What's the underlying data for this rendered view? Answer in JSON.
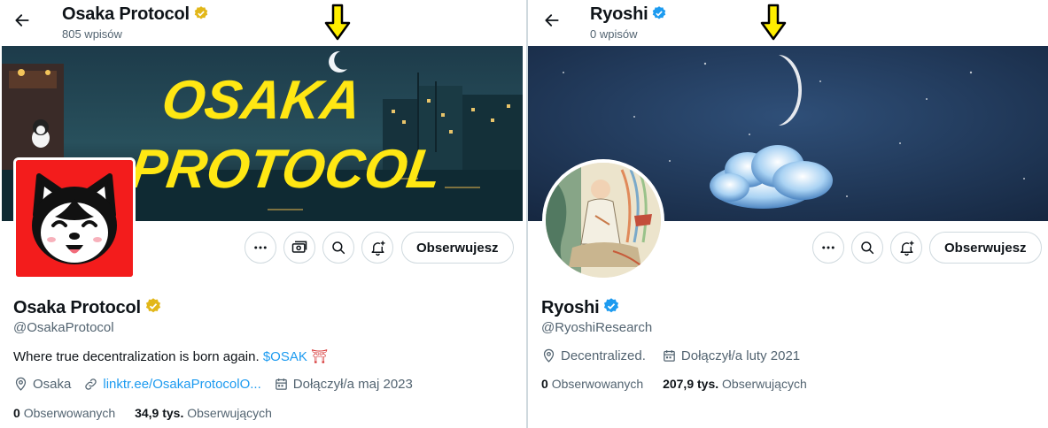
{
  "left": {
    "header": {
      "title": "Osaka Protocol",
      "posts_count": "805 wpisów"
    },
    "banner": {
      "text_line1": "OSAKA",
      "text_line2": "PROTOCOL"
    },
    "profile": {
      "name": "Osaka Protocol",
      "handle": "@OsakaProtocol",
      "bio_text": "Where true decentralization is born again.",
      "bio_cashtag": "$OSAK",
      "bio_emoji": "⛩",
      "location": "Osaka",
      "link": "linktr.ee/OsakaProtocolO...",
      "joined": "Dołączył/a maj 2023",
      "following_count": "0",
      "following_label": "Obserwowanych",
      "followers_count": "34,9 tys.",
      "followers_label": "Obserwujących"
    },
    "actions": {
      "follow_label": "Obserwujesz"
    },
    "badge_color": "#e2b719"
  },
  "right": {
    "header": {
      "title": "Ryoshi",
      "posts_count": "0 wpisów"
    },
    "profile": {
      "name": "Ryoshi",
      "handle": "@RyoshiResearch",
      "location": "Decentralized.",
      "joined": "Dołączył/a luty 2021",
      "following_count": "0",
      "following_label": "Obserwowanych",
      "followers_count": "207,9 tys.",
      "followers_label": "Obserwujących"
    },
    "actions": {
      "follow_label": "Obserwujesz"
    },
    "badge_color": "#1d9bf0"
  },
  "colors": {
    "accent": "#1d9bf0",
    "marker": "#ffee00",
    "avatar_red": "#f31c1c"
  }
}
